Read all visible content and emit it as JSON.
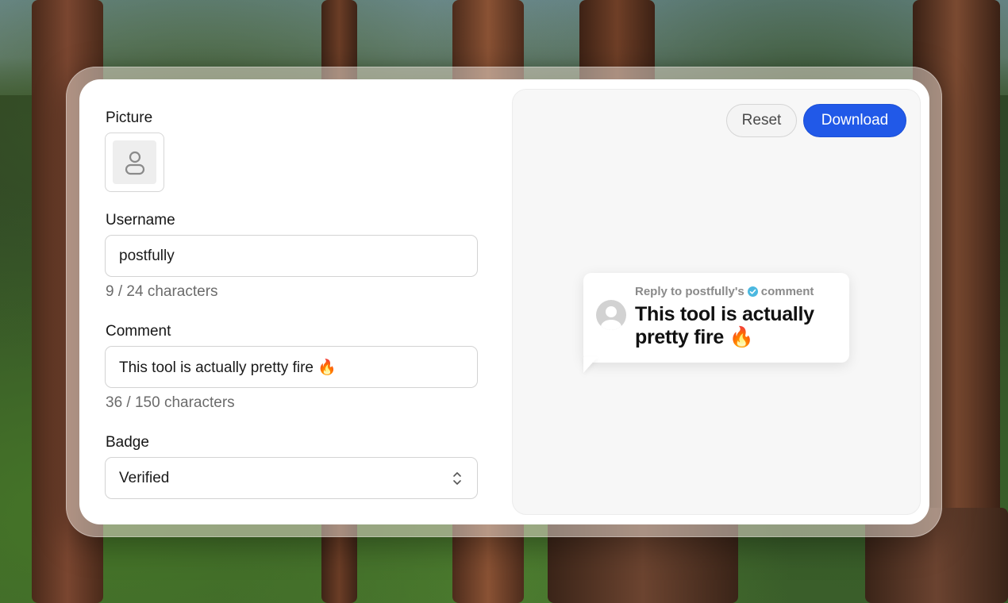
{
  "form": {
    "picture_label": "Picture",
    "username_label": "Username",
    "username_value": "postfully",
    "username_count": "9 / 24 characters",
    "comment_label": "Comment",
    "comment_value": "This tool is actually pretty fire 🔥",
    "comment_count": "36 / 150 characters",
    "badge_label": "Badge",
    "badge_value": "Verified"
  },
  "toolbar": {
    "reset_label": "Reset",
    "download_label": "Download"
  },
  "preview": {
    "reply_prefix": "Reply to postfully's",
    "reply_suffix": "comment",
    "comment_text": "This tool is actually pretty fire 🔥"
  },
  "colors": {
    "accent": "#2159e8",
    "verified_badge": "#4bb8e0"
  },
  "icons": {
    "picture_placeholder": "user-icon",
    "badge_select": "chevron-up-down-icon",
    "badge": "verified-check-icon",
    "avatar": "default-avatar-icon"
  }
}
